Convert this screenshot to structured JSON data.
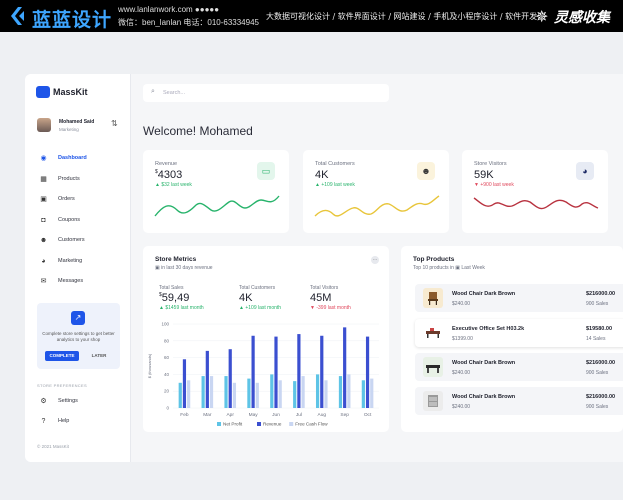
{
  "banner": {
    "brand": "蓝蓝设计",
    "site": "www.lanlanwork.com  ●●●●●",
    "contact": "微信：ben_lanlan    电话：010-63334945",
    "services": "大数据可视化设计  /  软件界面设计  /  网站建设  /  手机及小程序设计  /  软件开发",
    "tagline": "灵感收集"
  },
  "app": {
    "name": "MassKit",
    "profile": {
      "name": "Mohamed Said",
      "role": "Marketing"
    },
    "nav": [
      {
        "label": "Dashboard",
        "icon": "dashboard-icon",
        "active": true
      },
      {
        "label": "Products",
        "icon": "products-icon"
      },
      {
        "label": "Orders",
        "icon": "orders-icon"
      },
      {
        "label": "Coupons",
        "icon": "coupons-icon"
      },
      {
        "label": "Customers",
        "icon": "customers-icon"
      },
      {
        "label": "Marketing",
        "icon": "marketing-icon"
      },
      {
        "label": "Messages",
        "icon": "messages-icon"
      }
    ],
    "promo": {
      "text": "Complete store settings to get better analytics to your shop",
      "complete": "COMPLETE",
      "later": "LATER"
    },
    "preferences_heading": "STORE PREFERENCES",
    "preferences": [
      {
        "label": "Settings",
        "icon": "gear-icon"
      },
      {
        "label": "Help",
        "icon": "help-icon"
      }
    ],
    "copyright": "© 2021 MassKit"
  },
  "search": {
    "placeholder": "Search..."
  },
  "welcome": "Welcome! Mohamed",
  "stats": [
    {
      "label": "Revenue",
      "currency": "$",
      "value": "4303",
      "change": "▲ $32 last week",
      "trend": "up",
      "color": "#27b36b"
    },
    {
      "label": "Total Customers",
      "currency": "",
      "value": "4K",
      "change": "▲ +109 last week",
      "trend": "up",
      "color": "#e8c53a"
    },
    {
      "label": "Store Visitors",
      "currency": "",
      "value": "59K",
      "change": "▼ +900 last week",
      "trend": "down",
      "color": "#b8323f"
    }
  ],
  "store_metrics": {
    "title": "Store Metrics",
    "subtitle": "in last 30 days revenue",
    "metrics": [
      {
        "label": "Total Sales",
        "currency": "$",
        "value": "59,49",
        "change": "▲ $1459 last month",
        "trend": "up"
      },
      {
        "label": "Total Customers",
        "currency": "",
        "value": "4K",
        "change": "▲ +109 last month",
        "trend": "up"
      },
      {
        "label": "Total Visitors",
        "currency": "",
        "value": "45M",
        "change": "▼ -399 last month",
        "trend": "down"
      }
    ]
  },
  "chart_data": {
    "type": "bar",
    "ylabel": "$ (thousands)",
    "yticks": [
      0,
      20,
      40,
      60,
      80,
      100
    ],
    "ylim": [
      0,
      100
    ],
    "categories": [
      "Feb",
      "Mar",
      "Apr",
      "May",
      "Jun",
      "Jul",
      "Aug",
      "Sep",
      "Oct"
    ],
    "series": [
      {
        "name": "Net Profit",
        "color": "#5ec4e6",
        "values": [
          30,
          38,
          38,
          35,
          40,
          32,
          40,
          38,
          33
        ]
      },
      {
        "name": "Revenue",
        "color": "#3b4fd0",
        "values": [
          58,
          68,
          70,
          86,
          85,
          88,
          86,
          96,
          85
        ]
      },
      {
        "name": "Free Cash Flow",
        "color": "#c9d6f2",
        "values": [
          33,
          38,
          30,
          30,
          33,
          38,
          33,
          40,
          35
        ]
      }
    ],
    "legend": "bottom"
  },
  "top_products": {
    "title": "Top Products",
    "subtitle": "Top 10 products in",
    "period": "Last Week",
    "items": [
      {
        "name": "Wood Chair Dark Brown",
        "price": "$240.00",
        "total": "$216000.00",
        "sales": "900 Sales"
      },
      {
        "name": "Executive Office Set H03.2k",
        "price": "$1399.00",
        "total": "$19580.00",
        "sales": "14 Sales"
      },
      {
        "name": "Wood Chair Dark Brown",
        "price": "$240.00",
        "total": "$216000.00",
        "sales": "900 Sales"
      },
      {
        "name": "Wood Chair Dark Brown",
        "price": "$240.00",
        "total": "$216000.00",
        "sales": "900 Sales"
      }
    ]
  }
}
